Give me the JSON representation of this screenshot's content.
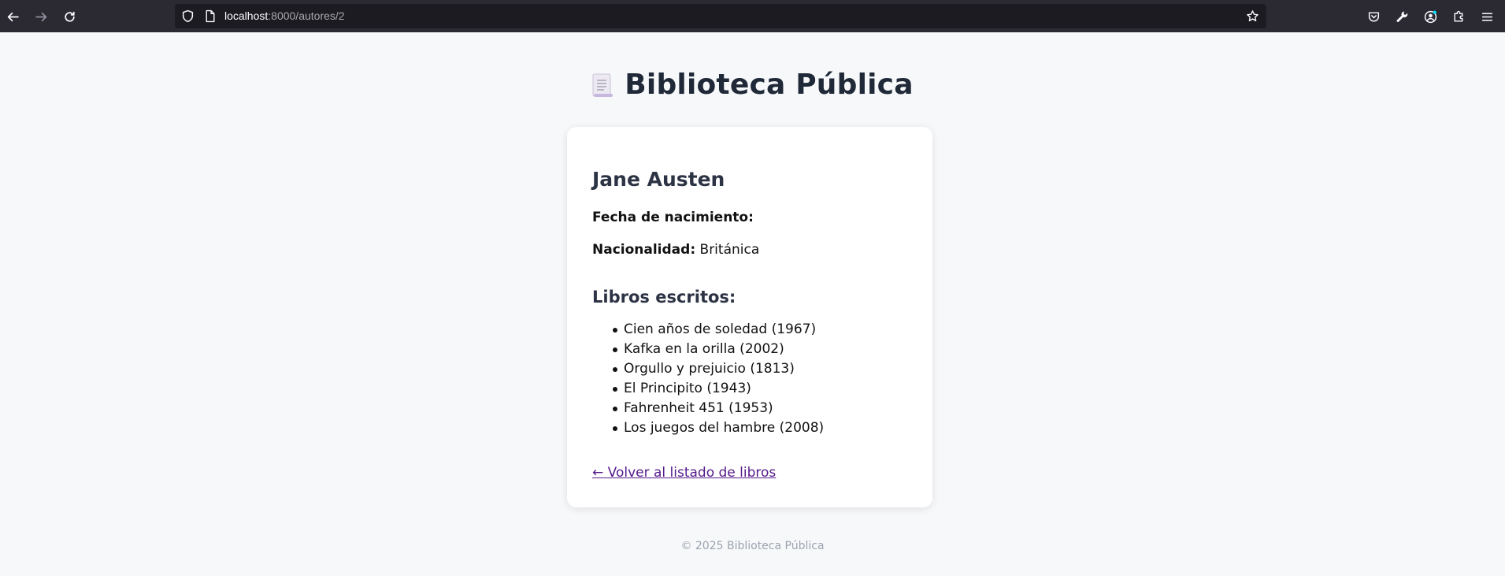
{
  "browser": {
    "url_host": "localhost",
    "url_path": ":8000/autores/2"
  },
  "site": {
    "title": "Biblioteca Pública",
    "title_icon": "scroll-icon"
  },
  "author": {
    "name": "Jane Austen",
    "birth_label": "Fecha de nacimiento:",
    "birth_value": "",
    "nationality_label": "Nacionalidad:",
    "nationality_value": "Británica"
  },
  "books": {
    "title": "Libros escritos:",
    "items": [
      "Cien años de soledad (1967)",
      "Kafka en la orilla (2002)",
      "Orgullo y prejuicio (1813)",
      "El Principito (1943)",
      "Fahrenheit 451 (1953)",
      "Los juegos del hambre (2008)"
    ]
  },
  "back_link": "← Volver al listado de libros",
  "footer": "© 2025 Biblioteca Pública",
  "colors": {
    "toolbar_bg": "#2b2a33",
    "urlbar_bg": "#1c1b22",
    "page_bg": "#f7f8fa",
    "link": "#551a8b"
  }
}
